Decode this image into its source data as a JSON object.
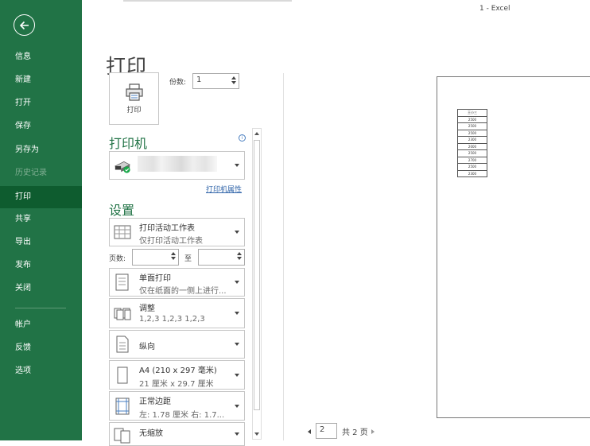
{
  "window": {
    "title": "1  -  Excel"
  },
  "nav": {
    "items": [
      {
        "label": "信息"
      },
      {
        "label": "新建"
      },
      {
        "label": "打开"
      },
      {
        "label": "保存"
      },
      {
        "label": "另存为"
      },
      {
        "label": "历史记录"
      },
      {
        "label": "打印"
      },
      {
        "label": "共享"
      },
      {
        "label": "导出"
      },
      {
        "label": "发布"
      },
      {
        "label": "关闭"
      },
      {
        "label": "帐户"
      },
      {
        "label": "反馈"
      },
      {
        "label": "选项"
      }
    ],
    "active_item": "打印",
    "disabled_item": "历史记录"
  },
  "main": {
    "title": "打印",
    "print_button": {
      "label": "打印"
    },
    "copies": {
      "label": "份数:",
      "value": "1"
    },
    "printer_section": "打印机",
    "printer_properties_link": "打印机属性",
    "settings_section": "设置",
    "settings": [
      {
        "line1": "打印活动工作表",
        "line2": "仅打印活动工作表"
      },
      {
        "line1": "单面打印",
        "line2": "仅在纸面的一侧上进行..."
      },
      {
        "line1": "调整",
        "line2": "1,2,3    1,2,3    1,2,3"
      },
      {
        "line1": "纵向",
        "line2": ""
      },
      {
        "line1": "A4 (210 x 297 毫米)",
        "line2": "21 厘米 x 29.7 厘米"
      },
      {
        "line1": "正常边距",
        "line2": "左: 1.78 厘米    右: 1.7..."
      },
      {
        "line1": "无缩放",
        "line2": ""
      }
    ],
    "pages": {
      "label": "页数:",
      "to_label": "至",
      "from_value": "",
      "to_value": ""
    }
  },
  "preview": {
    "table_rows": [
      "王小三",
      "2500",
      "2500",
      "2500",
      "2300",
      "2000",
      "2500",
      "2700",
      "2500",
      "2300"
    ],
    "pager": {
      "current": "2",
      "total_label": "共 2 页"
    }
  },
  "colors": {
    "nav_bg": "#217346",
    "nav_active": "#0e5c2f",
    "accent": "#217346",
    "link": "#2e63a8"
  }
}
